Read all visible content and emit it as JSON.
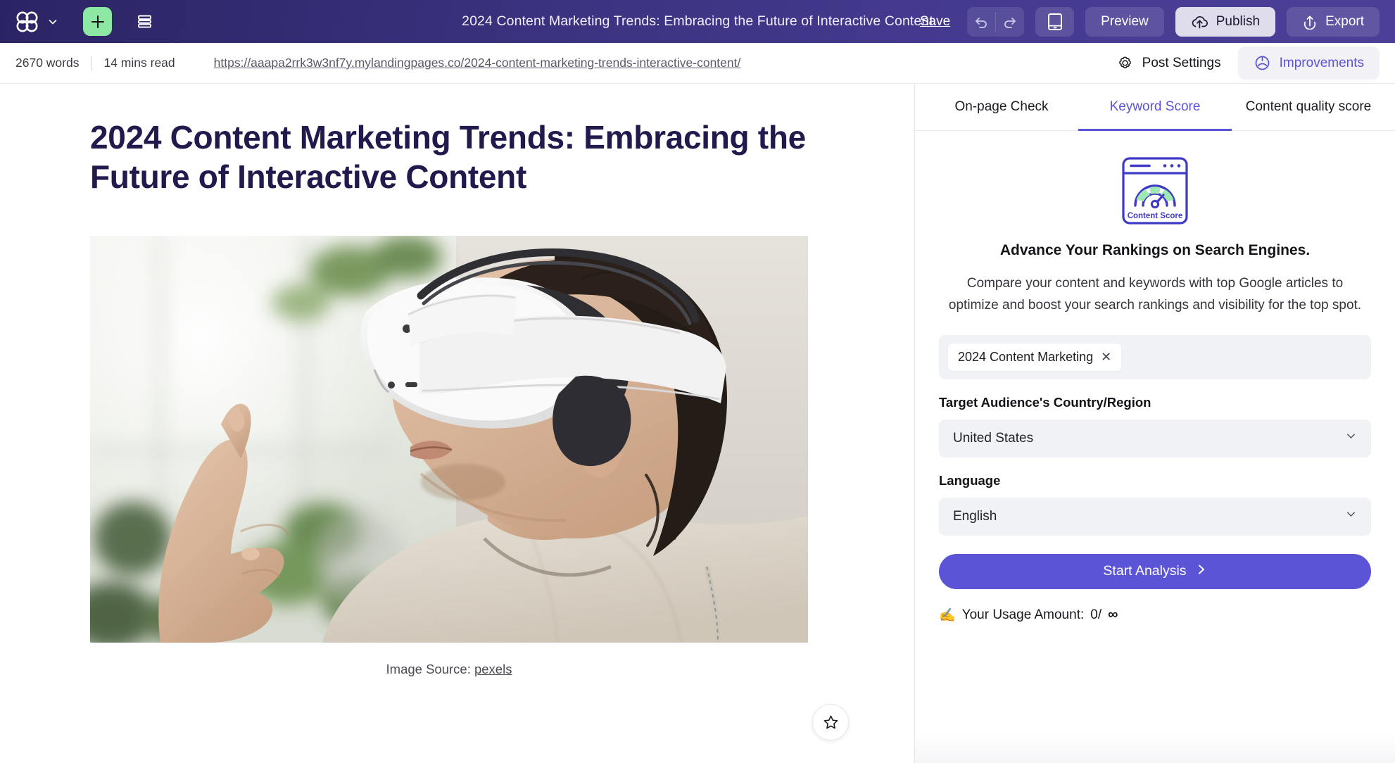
{
  "topbar": {
    "logo_icon": "app-logo-icon",
    "logo_chevron_icon": "chevron-down-icon",
    "add_icon": "plus-icon",
    "layout_icon": "layout-rows-icon",
    "document_title": "2024 Content Marketing Trends: Embracing the Future of Interactive Content",
    "save_label": "Save",
    "undo_icon": "undo-icon",
    "redo_icon": "redo-icon",
    "device_icon": "tablet-device-icon",
    "preview_label": "Preview",
    "publish_label": "Publish",
    "publish_icon": "cloud-upload-icon",
    "export_label": "Export",
    "export_icon": "upload-icon",
    "bg_color": "#3a3184",
    "accent_green": "#8ce8a2"
  },
  "subbar": {
    "word_count": "2670 words",
    "read_time": "14 mins read",
    "url": "https://aaapa2rrk3w3nf7y.mylandingpages.co/2024-content-marketing-trends-interactive-content/",
    "post_settings_label": "Post Settings",
    "post_settings_icon": "gear-icon",
    "improvements_label": "Improvements",
    "improvements_icon": "lightbulb-idea-icon",
    "improvements_color": "#5b54d6"
  },
  "document": {
    "title": "2024 Content Marketing Trends: Embracing the Future of Interactive Content",
    "title_color": "#201a4d",
    "caption_prefix": "Image Source:",
    "caption_link": "pexels",
    "favorite_icon": "star-outline-icon",
    "hero_alt": "Person wearing a white VR headset pointing a finger upward near a bright window with plants"
  },
  "side_panel": {
    "tabs": [
      {
        "label": "On-page Check",
        "active": false
      },
      {
        "label": "Keyword Score",
        "active": true
      },
      {
        "label": "Content quality score",
        "active": false
      }
    ],
    "score_icon_label": "Content Score",
    "score_icon": "content-score-gauge-icon",
    "heading": "Advance Your Rankings on Search Engines.",
    "description": "Compare your content and keywords with top Google articles to optimize and boost your search rankings and visibility for the top spot.",
    "keywords": [
      {
        "label": "2024 Content Marketing",
        "remove_icon": "close-icon"
      }
    ],
    "country_label": "Target Audience's Country/Region",
    "country_value": "United States",
    "country_chevron_icon": "chevron-down-icon",
    "language_label": "Language",
    "language_value": "English",
    "language_chevron_icon": "chevron-down-icon",
    "cta_label": "Start Analysis",
    "cta_chevron_icon": "chevron-right-icon",
    "usage_emoji": "✍️",
    "usage_label": "Your Usage Amount:",
    "usage_value": "0/",
    "usage_limit": "∞",
    "accent_color": "#5b54d6"
  }
}
